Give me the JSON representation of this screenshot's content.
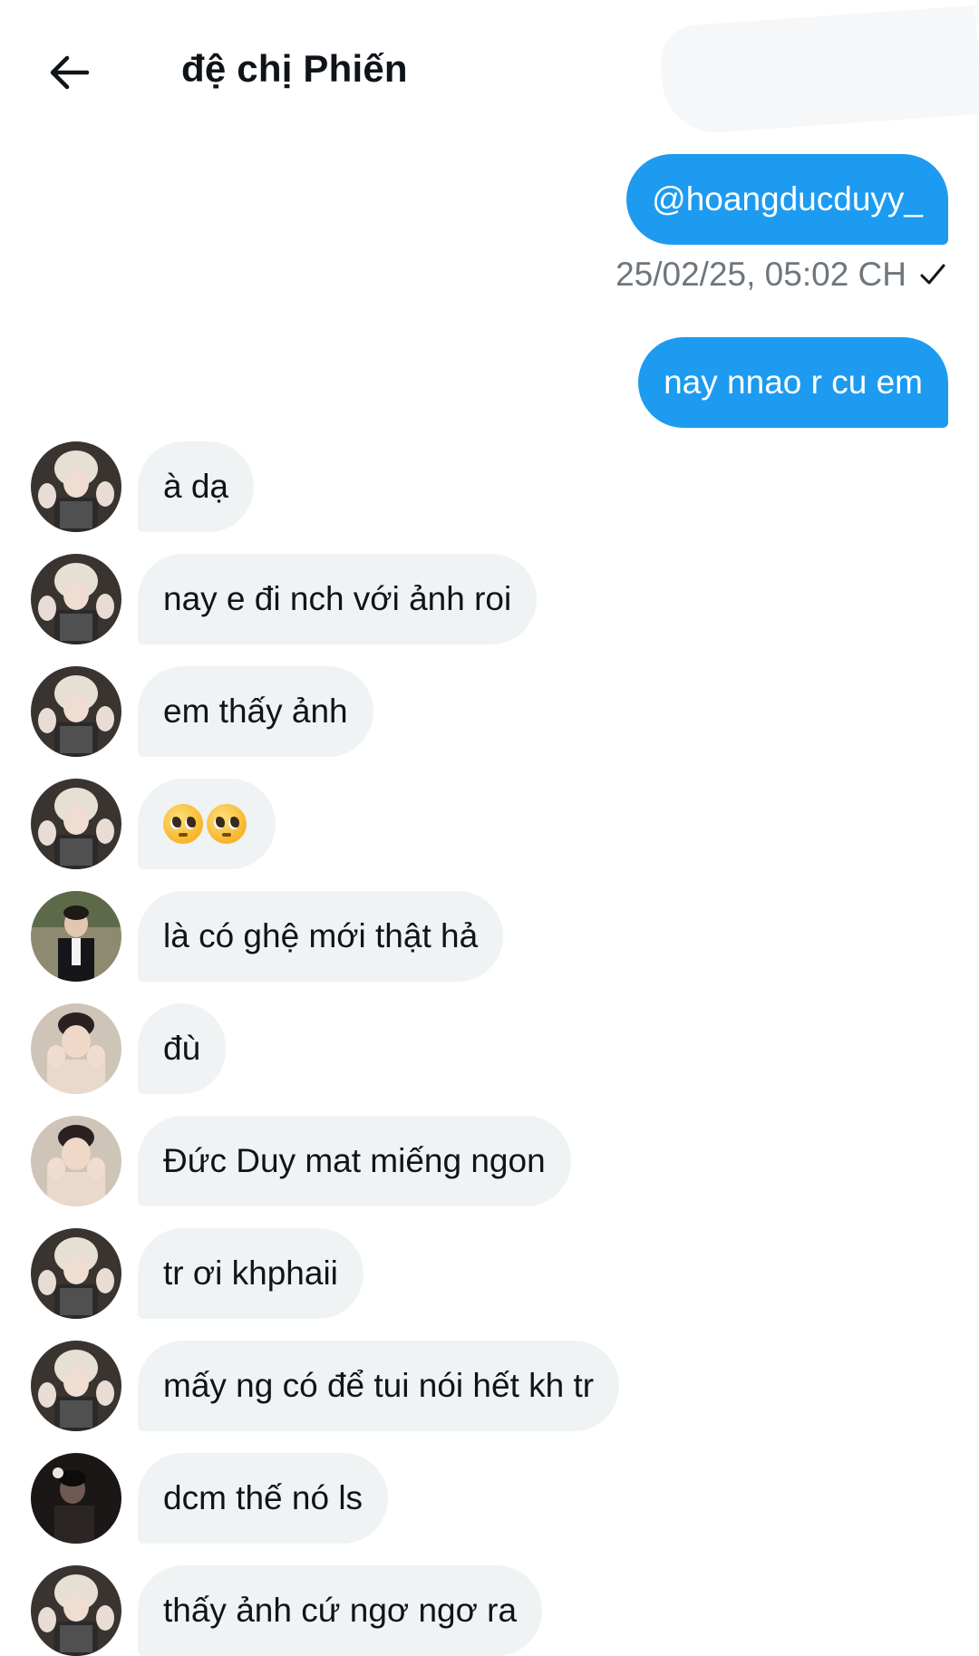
{
  "header": {
    "title": "đệ chị Phiến",
    "back_icon": "arrow-left-icon"
  },
  "colors": {
    "accent": "#1d9bf0",
    "incoming_bubble": "#eff3f4",
    "timestamp_text": "#6e767d"
  },
  "outgoing": [
    {
      "text": "@hoangducduyy_"
    },
    {
      "text": "nay nnao r cu em"
    }
  ],
  "timestamp": {
    "text": "25/02/25, 05:02 CH",
    "status_icon": "checkmark-icon"
  },
  "incoming": [
    {
      "text": "à dạ",
      "avatar": "avatar-a"
    },
    {
      "text": "nay e đi nch với ảnh roi",
      "avatar": "avatar-a"
    },
    {
      "text": "em thấy ảnh",
      "avatar": "avatar-a"
    },
    {
      "text": "🥺🥺",
      "avatar": "avatar-a",
      "emoji": "pleading-face"
    },
    {
      "text": "là có ghệ mới thật hả",
      "avatar": "avatar-b"
    },
    {
      "text": "đù",
      "avatar": "avatar-c"
    },
    {
      "text": "Đức Duy mat miếng ngon",
      "avatar": "avatar-c"
    },
    {
      "text": "tr ơi khphaii",
      "avatar": "avatar-a"
    },
    {
      "text": "mấy ng có để tui nói hết kh tr",
      "avatar": "avatar-a"
    },
    {
      "text": "dcm thế nó ls",
      "avatar": "avatar-d"
    },
    {
      "text": "thấy ảnh cứ ngơ ngơ ra",
      "avatar": "avatar-a"
    }
  ]
}
